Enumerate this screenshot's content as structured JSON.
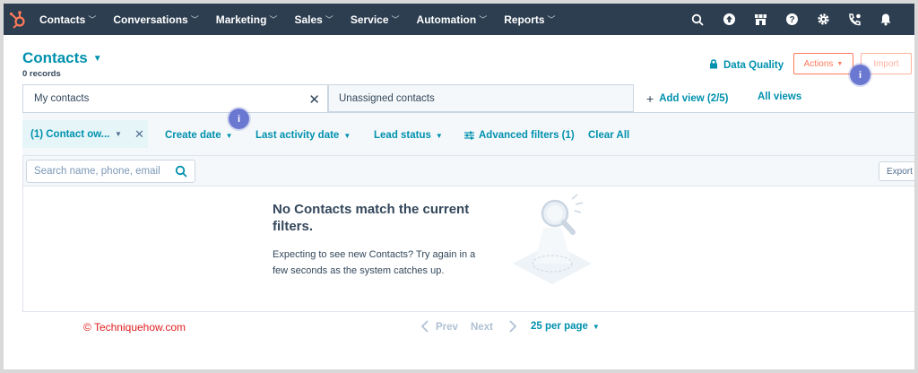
{
  "nav": {
    "items": [
      {
        "label": "Contacts"
      },
      {
        "label": "Conversations"
      },
      {
        "label": "Marketing"
      },
      {
        "label": "Sales"
      },
      {
        "label": "Service"
      },
      {
        "label": "Automation"
      },
      {
        "label": "Reports"
      }
    ],
    "icons": [
      "search-icon",
      "upgrade-icon",
      "marketplace-icon",
      "help-icon",
      "settings-icon",
      "calling-icon",
      "notifications-icon"
    ]
  },
  "header": {
    "title": "Contacts",
    "records": "0 records",
    "data_quality": "Data Quality",
    "actions": "Actions",
    "import": "Import"
  },
  "tabs": {
    "active": "My contacts",
    "inactive": "Unassigned contacts",
    "add_view": "Add view (2/5)",
    "all_views": "All views"
  },
  "filters": {
    "owner_chip": "(1) Contact ow...",
    "create_date": "Create date",
    "last_activity_date": "Last activity date",
    "lead_status": "Lead status",
    "advanced_filters": "Advanced filters (1)",
    "clear_all": "Clear All"
  },
  "table": {
    "search_placeholder": "Search name, phone, email",
    "export": "Export",
    "empty_title": "No Contacts match the current filters.",
    "empty_desc": "Expecting to see new Contacts? Try again in a few seconds as the system catches up."
  },
  "footer": {
    "watermark": "© Techniquehow.com",
    "prev": "Prev",
    "next": "Next",
    "per_page": "25 per page"
  },
  "info_badge": "i",
  "colors": {
    "nav_bg": "#2d3e50",
    "link": "#0091ae",
    "accent_orange": "#ff7a59",
    "info_badge": "#6a78d1",
    "watermark": "#e02020"
  }
}
